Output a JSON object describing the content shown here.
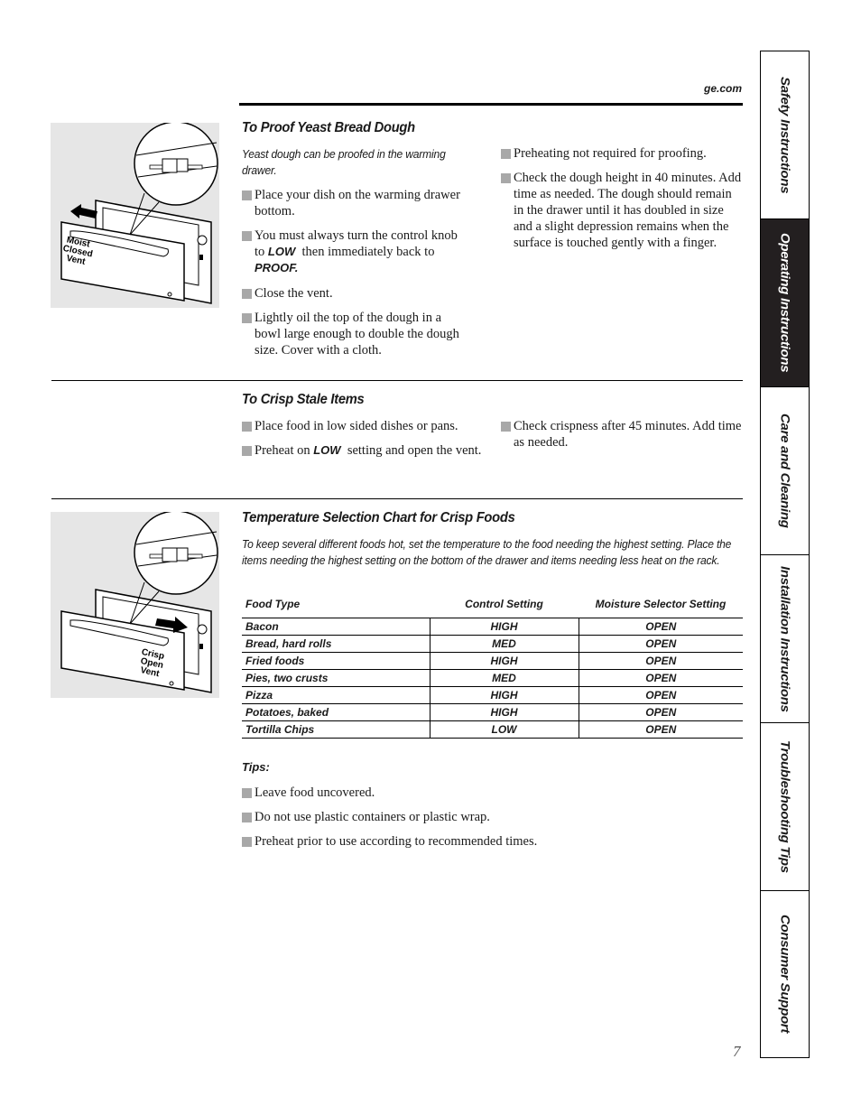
{
  "header": {
    "url": "ge.com"
  },
  "sections": {
    "proof": {
      "title": "To Proof Yeast Bread Dough",
      "intro": "Yeast dough can be proofed in the warming drawer.",
      "illustration_label": [
        "Moist",
        "Closed",
        "Vent"
      ],
      "left_bullets": [
        {
          "text": "Place your dish on the warming drawer bottom."
        },
        {
          "pre": "You must always turn the control knob to ",
          "em1": "LOW",
          "mid": "  then immediately back to ",
          "em2": "PROOF."
        },
        {
          "text": "Close the vent."
        },
        {
          "text": "Lightly oil the top of the dough in a bowl large enough to double the dough size. Cover with a cloth."
        }
      ],
      "right_bullets": [
        {
          "text": "Preheating not required for proofing."
        },
        {
          "text": "Check the dough height in 40 minutes. Add time as needed. The dough should remain in the drawer until it has doubled in size and a slight depression remains when the surface is touched gently with a finger."
        }
      ]
    },
    "crisp": {
      "title": "To Crisp Stale Items",
      "left_bullets": [
        {
          "text": "Place food in low sided dishes or pans."
        },
        {
          "pre": "Preheat on ",
          "em1": "LOW",
          "post": "  setting and open the vent."
        }
      ],
      "right_bullets": [
        {
          "text": "Check crispness after 45 minutes. Add time as needed."
        }
      ]
    },
    "chart": {
      "title": "Temperature Selection Chart for Crisp Foods",
      "intro": "To keep several different foods hot, set the temperature to the food needing the highest setting. Place the items needing the highest setting on the bottom of the drawer and items needing less heat on the rack.",
      "illustration_label": [
        "Crisp",
        "Open",
        "Vent"
      ],
      "tips_label": "Tips:",
      "tips": [
        "Leave food uncovered.",
        "Do not use plastic containers or plastic wrap.",
        "Preheat prior to use according to recommended times."
      ]
    }
  },
  "chart_data": {
    "type": "table",
    "title": "Temperature Selection Chart for Crisp Foods",
    "columns": [
      "Food Type",
      "Control Setting",
      "Moisture Selector Setting"
    ],
    "rows": [
      [
        "Bacon",
        "HIGH",
        "OPEN"
      ],
      [
        "Bread, hard rolls",
        "MED",
        "OPEN"
      ],
      [
        "Fried foods",
        "HIGH",
        "OPEN"
      ],
      [
        "Pies, two crusts",
        "MED",
        "OPEN"
      ],
      [
        "Pizza",
        "HIGH",
        "OPEN"
      ],
      [
        "Potatoes, baked",
        "HIGH",
        "OPEN"
      ],
      [
        "Tortilla Chips",
        "LOW",
        "OPEN"
      ]
    ]
  },
  "side_tabs": [
    {
      "label": "Safety Instructions",
      "active": false
    },
    {
      "label": "Operating Instructions",
      "active": true
    },
    {
      "label": "Care and Cleaning",
      "active": false
    },
    {
      "label": "Installation Instructions",
      "active": false
    },
    {
      "label": "Troubleshooting Tips",
      "active": false
    },
    {
      "label": "Consumer Support",
      "active": false
    }
  ],
  "footer": {
    "page_number": "7"
  }
}
